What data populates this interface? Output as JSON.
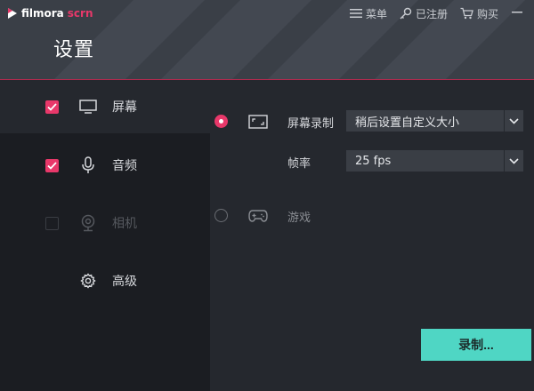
{
  "app": {
    "brand_main": "filmora",
    "brand_accent": "scrn",
    "page_title": "设置"
  },
  "topnav": {
    "menu": "菜单",
    "registered": "已注册",
    "buy": "购买"
  },
  "sidebar": {
    "items": [
      {
        "label": "屏幕",
        "checked": true,
        "enabled": true
      },
      {
        "label": "音频",
        "checked": true,
        "enabled": true
      },
      {
        "label": "相机",
        "checked": false,
        "enabled": false
      },
      {
        "label": "高级"
      }
    ]
  },
  "screen_panel": {
    "screen_record_label": "屏幕录制",
    "screen_record_value": "稍后设置自定义大小",
    "framerate_label": "帧率",
    "framerate_value": "25 fps",
    "game_label": "游戏"
  },
  "actions": {
    "record_label": "录制..."
  },
  "colors": {
    "accent": "#e8386a",
    "record_button": "#4fd6c4",
    "header_bg": "#3a3f47",
    "sidebar_bg": "#1b1d22",
    "panel_bg": "#25282e"
  }
}
